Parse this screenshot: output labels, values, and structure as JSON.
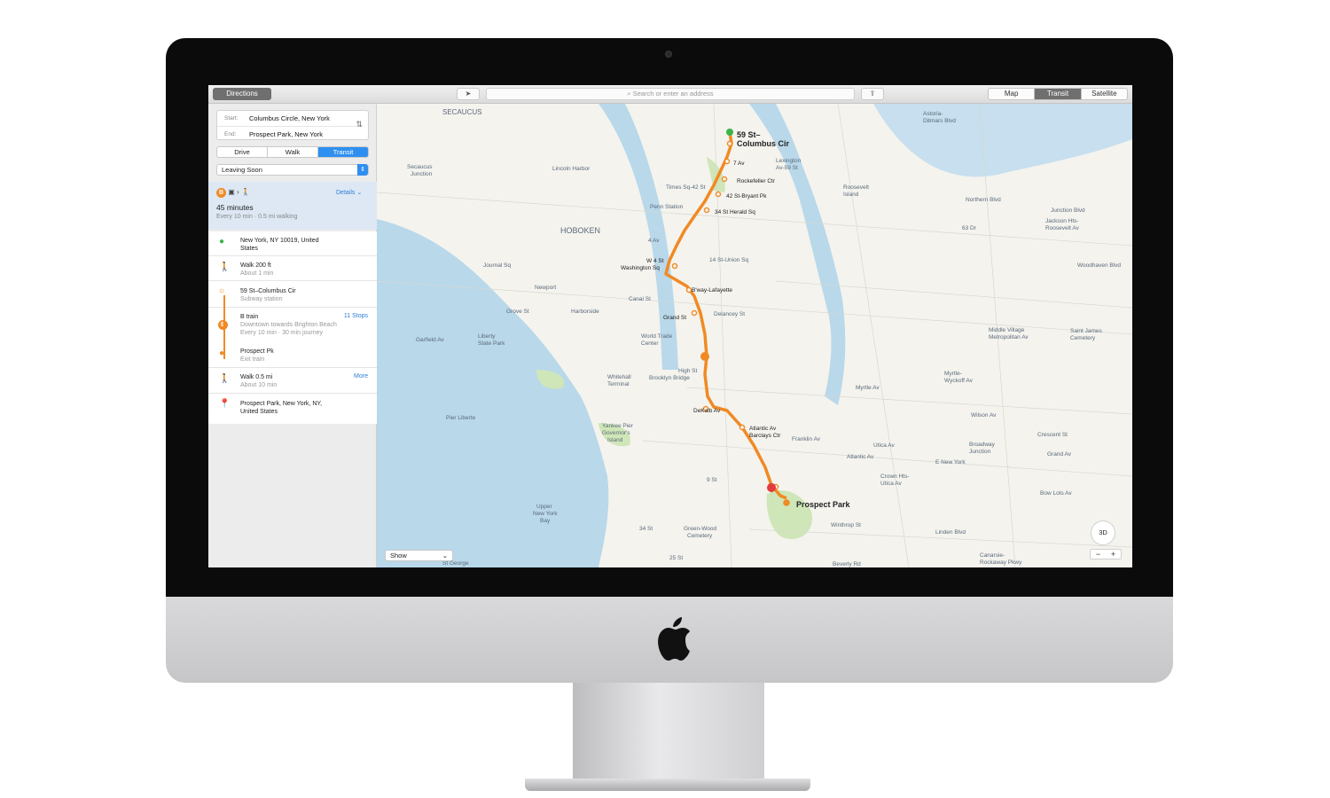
{
  "toolbar": {
    "directions_label": "Directions",
    "search_placeholder": "Search or enter an address",
    "map_modes": [
      "Map",
      "Transit",
      "Satellite"
    ],
    "active_map_mode": "Transit"
  },
  "sidebar": {
    "start_key": "Start:",
    "start_value": "Columbus Circle, New York",
    "end_key": "End:",
    "end_value": "Prospect Park, New York",
    "modes": [
      "Drive",
      "Walk",
      "Transit"
    ],
    "active_mode": "Transit",
    "leaving": "Leaving Soon",
    "details_label": "Details",
    "duration": "45 minutes",
    "frequency": "Every 10 min · 0.5 mi walking",
    "steps": [
      {
        "t1": "New York, NY  10019, United",
        "t2": "States",
        "icon": "green-pin-icon"
      },
      {
        "t1": "Walk 200 ft",
        "t2": "About 1 min",
        "icon": "walk-icon"
      },
      {
        "t1": "59 St–Columbus Cir",
        "t2": "Subway station",
        "icon": "station-icon"
      },
      {
        "t1": "B train",
        "t2": "Downtown towards Brighton Beach",
        "t3": "Every 10 min · 30 min journey",
        "right": "11 Stops",
        "icon": "b-train-icon"
      },
      {
        "t1": "Prospect Pk",
        "t2": "Exit train",
        "icon": "station-icon"
      },
      {
        "t1": "Walk 0.5 mi",
        "t2": "About 10 min",
        "right": "More",
        "icon": "walk-icon"
      },
      {
        "t1": "Prospect Park, New York, NY,",
        "t2": "United States",
        "icon": "red-pin-icon"
      }
    ],
    "show_label": "Show"
  },
  "map": {
    "route_color": "#f08a24",
    "water_color": "#b9d8ea",
    "land_color": "#f4f3ee",
    "park_color": "#cfe6b8",
    "labels": [
      {
        "text": "SECAUCUS"
      },
      {
        "text": "HOBOKEN"
      },
      {
        "text": "59 St–"
      },
      {
        "text": "Columbus Cir"
      },
      {
        "text": "7 Av"
      },
      {
        "text": "Rockefeller Ctr"
      },
      {
        "text": "42 St-Bryant Pk"
      },
      {
        "text": "34 St Herald Sq"
      },
      {
        "text": "W 4 St"
      },
      {
        "text": "Washington Sq"
      },
      {
        "text": "B'way-Lafayette"
      },
      {
        "text": "Grand St"
      },
      {
        "text": "DeKalb Av"
      },
      {
        "text": "Atlantic Av"
      },
      {
        "text": "Barclays Ctr"
      },
      {
        "text": "Prospect Park"
      },
      {
        "text": "Times Sq-42 St"
      },
      {
        "text": "Penn Station"
      },
      {
        "text": "14 St-Union Sq"
      },
      {
        "text": "Delancey St"
      },
      {
        "text": "World Trade"
      },
      {
        "text": "Center"
      },
      {
        "text": "Lincoln Harbor"
      },
      {
        "text": "Secaucus"
      },
      {
        "text": "Junction"
      },
      {
        "text": "Newport"
      },
      {
        "text": "Liberty"
      },
      {
        "text": "State Park"
      },
      {
        "text": "Upper"
      },
      {
        "text": "New York"
      },
      {
        "text": "Bay"
      },
      {
        "text": "Astoria-"
      },
      {
        "text": "Ditmars Blvd"
      },
      {
        "text": "Northern Blvd"
      },
      {
        "text": "Junction Blvd"
      },
      {
        "text": "63 Dr"
      },
      {
        "text": "Woodhaven Blvd"
      },
      {
        "text": "Middle Village"
      },
      {
        "text": "Metropolitan Av"
      },
      {
        "text": "Myrtle Av"
      },
      {
        "text": "Wilson Av"
      },
      {
        "text": "Broadway"
      },
      {
        "text": "Junction"
      },
      {
        "text": "Crescent St"
      },
      {
        "text": "Grand Av"
      },
      {
        "text": "Franklin Av"
      },
      {
        "text": "Utica Av"
      },
      {
        "text": "Crown Hts-"
      },
      {
        "text": "Utica Av"
      },
      {
        "text": "Winthrop St"
      },
      {
        "text": "Green-Wood"
      },
      {
        "text": "Cemetery"
      },
      {
        "text": "Beverly Rd"
      },
      {
        "text": "Canarsie-"
      },
      {
        "text": "Rockaway Pkwy"
      },
      {
        "text": "Jackson Hts-"
      },
      {
        "text": "Roosevelt Av"
      },
      {
        "text": "Roosevelt"
      },
      {
        "text": "Island"
      },
      {
        "text": "Lexington"
      },
      {
        "text": "Av-59 St"
      },
      {
        "text": "Yankee Pier"
      },
      {
        "text": "Governor's"
      },
      {
        "text": "Island"
      },
      {
        "text": "Pier Liberte"
      },
      {
        "text": "Brooklyn Bridge"
      },
      {
        "text": "High St"
      },
      {
        "text": "Whitehall"
      },
      {
        "text": "Terminal"
      },
      {
        "text": "Bow Lots Av"
      },
      {
        "text": "Linden Blvd"
      },
      {
        "text": "E New York"
      },
      {
        "text": "Saint James"
      },
      {
        "text": "Cemetery"
      },
      {
        "text": "Atlantic Av"
      },
      {
        "text": "Myrtle-"
      },
      {
        "text": "Wyckoff Av"
      },
      {
        "text": "Journal Sq"
      },
      {
        "text": "Grove St"
      },
      {
        "text": "Harborside"
      },
      {
        "text": "Canal St"
      },
      {
        "text": "Garfield Av"
      },
      {
        "text": "9 St"
      },
      {
        "text": "34 St"
      },
      {
        "text": "25 St"
      },
      {
        "text": "4 Av"
      },
      {
        "text": "St George"
      }
    ]
  },
  "controls": {
    "compass_label": "3D",
    "zoom_out": "−",
    "zoom_in": "+"
  }
}
